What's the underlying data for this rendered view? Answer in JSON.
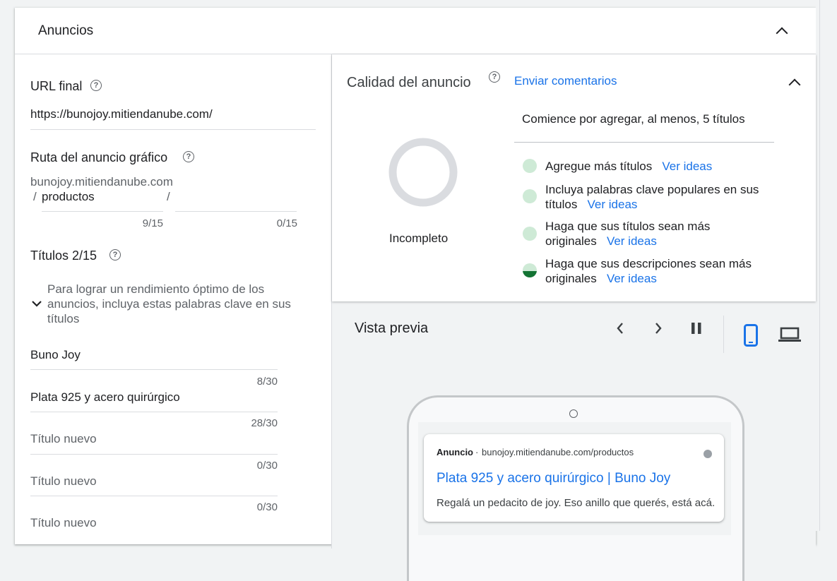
{
  "header": {
    "title": "Anuncios"
  },
  "url_final": {
    "label": "URL final",
    "value": "https://bunojoy.mitiendanube.com/"
  },
  "ruta": {
    "label": "Ruta del anuncio gráfico",
    "domain": "bunojoy.mitiendanube.com",
    "sep1": "/",
    "path1_value": "productos",
    "sep2": "/",
    "path1_counter": "9/15",
    "path2_counter": "0/15"
  },
  "titulos": {
    "label": "Títulos 2/15",
    "suggestion": [
      "Para lograr un rendimiento óptimo de los",
      "anuncios, incluya estas palabras clave en sus",
      "títulos"
    ],
    "items": [
      {
        "value": "Buno Joy",
        "counter": "8/30"
      },
      {
        "value": "Plata 925 y acero quirúrgico",
        "counter": "28/30"
      },
      {
        "placeholder": "Título nuevo",
        "counter": "0/30"
      },
      {
        "placeholder": "Título nuevo",
        "counter": "0/30"
      },
      {
        "placeholder": "Título nuevo"
      }
    ]
  },
  "calidad": {
    "title": "Calidad del anuncio",
    "feedback_link": "Enviar comentarios",
    "status": "Incompleto",
    "intro": "Comience por agregar, al menos, 5 títulos",
    "items": [
      {
        "lines": [
          "Agregue más títulos"
        ],
        "link": "Ver ideas",
        "progress": 0
      },
      {
        "lines": [
          "Incluya palabras clave populares en sus",
          "títulos"
        ],
        "link": "Ver ideas",
        "progress": 0
      },
      {
        "lines": [
          "Haga que sus títulos sean más",
          "originales"
        ],
        "link": "Ver ideas",
        "progress": 0
      },
      {
        "lines": [
          "Haga que sus descripciones sean más",
          "originales"
        ],
        "link": "Ver ideas",
        "progress": 0.45
      }
    ],
    "colors": {
      "pending": "#ceead6",
      "done": "#137333",
      "ring": "#dadce0"
    }
  },
  "preview": {
    "title": "Vista previa",
    "ad": {
      "badge": "Anuncio",
      "bullet": "·",
      "display_url": "bunojoy.mitiendanube.com/productos",
      "headline": "Plata 925 y acero quirúrgico | Buno Joy",
      "description": "Regalá un pedacito de joy. Eso anillo que querés, está acá."
    }
  },
  "accent": "#1a73e8"
}
